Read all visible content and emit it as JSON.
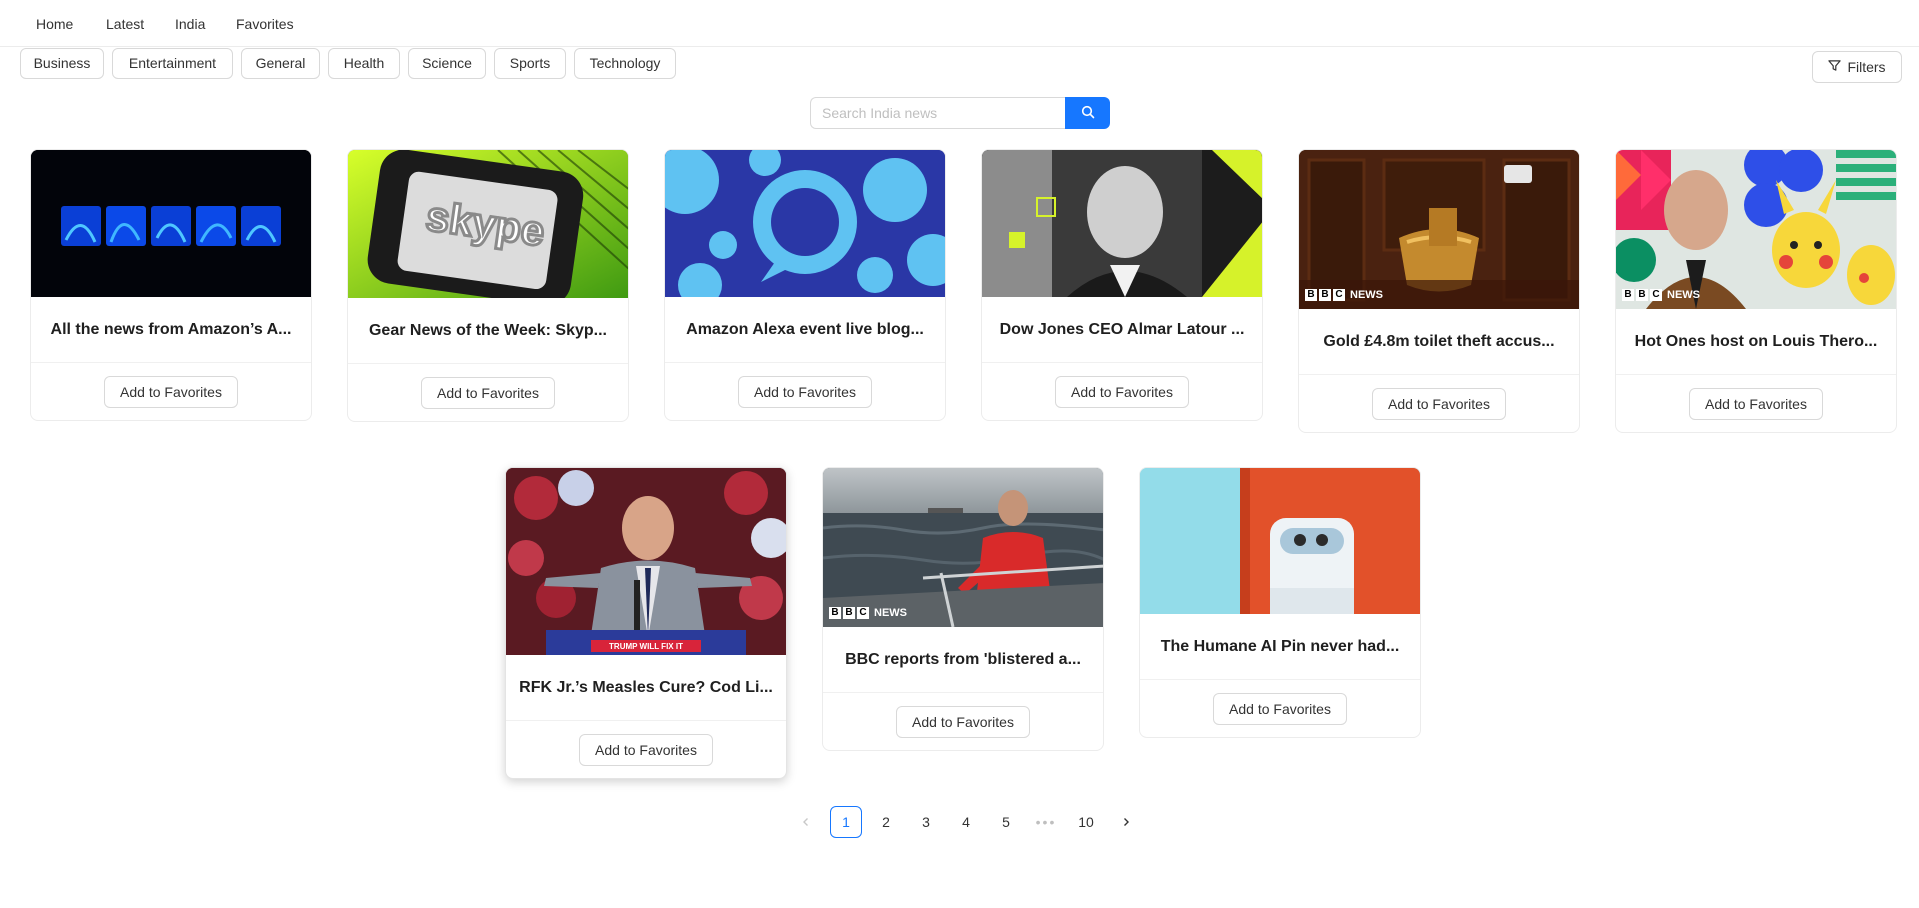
{
  "nav": {
    "home": "Home",
    "latest": "Latest",
    "india": "India",
    "favorites": "Favorites"
  },
  "categories": [
    "Business",
    "Entertainment",
    "General",
    "Health",
    "Science",
    "Sports",
    "Technology"
  ],
  "filters": {
    "label": "Filters",
    "icon": "filter-icon"
  },
  "search": {
    "placeholder": "Search India news",
    "icon": "search-icon",
    "accent": "#1677ff"
  },
  "fav_label": "Add to Favorites",
  "articles": [
    {
      "title": "All the news from Amazon’s A..."
    },
    {
      "title": "Gear News of the Week: Skyp...",
      "image_text": "skype"
    },
    {
      "title": "Amazon Alexa event live blog..."
    },
    {
      "title": "Dow Jones CEO Almar Latour ..."
    },
    {
      "title": "Gold £4.8m toilet theft accus...",
      "watermark": [
        "B",
        "B",
        "C",
        "NEWS"
      ]
    },
    {
      "title": "Hot Ones host on Louis Thero...",
      "watermark": [
        "B",
        "B",
        "C",
        "NEWS"
      ]
    },
    {
      "title": "RFK Jr.’s Measles Cure? Cod Li...",
      "podium_text": "TRUMP WILL FIX IT"
    },
    {
      "title": "BBC reports from 'blistered a...",
      "watermark": [
        "B",
        "B",
        "C",
        "NEWS"
      ]
    },
    {
      "title": "The Humane AI Pin never had..."
    }
  ],
  "pagination": {
    "pages": [
      "1",
      "2",
      "3",
      "4",
      "5",
      "10"
    ],
    "current": "1",
    "ellipsis": "•••",
    "prev_icon": "chevron-left-icon",
    "next_icon": "chevron-right-icon"
  }
}
